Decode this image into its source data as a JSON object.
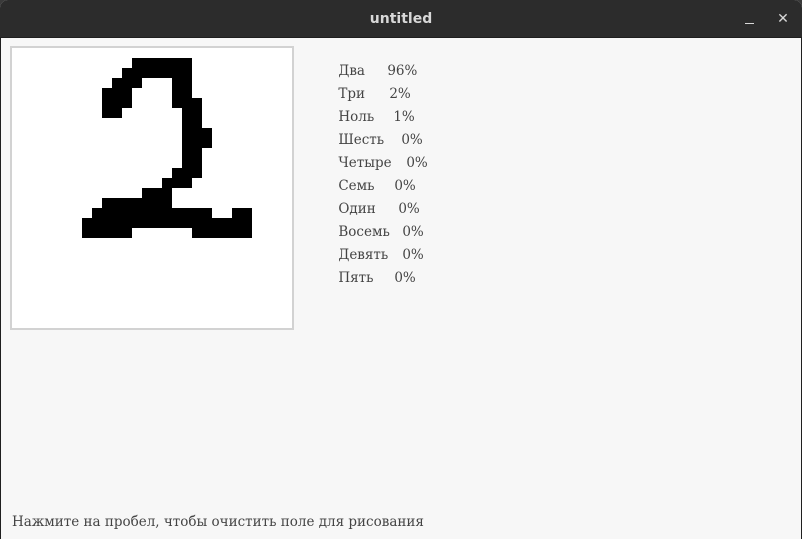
{
  "window": {
    "title": "untitled",
    "minimize_icon": "minimize-icon",
    "close_icon": "close-icon",
    "close_glyph": "✕"
  },
  "canvas": {
    "digit_drawn": "2",
    "background": "#ffffff",
    "ink": "#000000"
  },
  "predictions": [
    {
      "label": "Два",
      "value": "96%"
    },
    {
      "label": "Три",
      "value": "2%"
    },
    {
      "label": "Ноль",
      "value": "1%"
    },
    {
      "label": "Шесть",
      "value": "0%"
    },
    {
      "label": "Четыре",
      "value": "0%"
    },
    {
      "label": "Семь",
      "value": "0%"
    },
    {
      "label": "Один",
      "value": "0%"
    },
    {
      "label": "Восемь",
      "value": "0%"
    },
    {
      "label": "Девять",
      "value": "0%"
    },
    {
      "label": "Пять",
      "value": "0%"
    }
  ],
  "status": {
    "hint": "Нажмите на пробел, чтобы очистить поле для рисования"
  }
}
